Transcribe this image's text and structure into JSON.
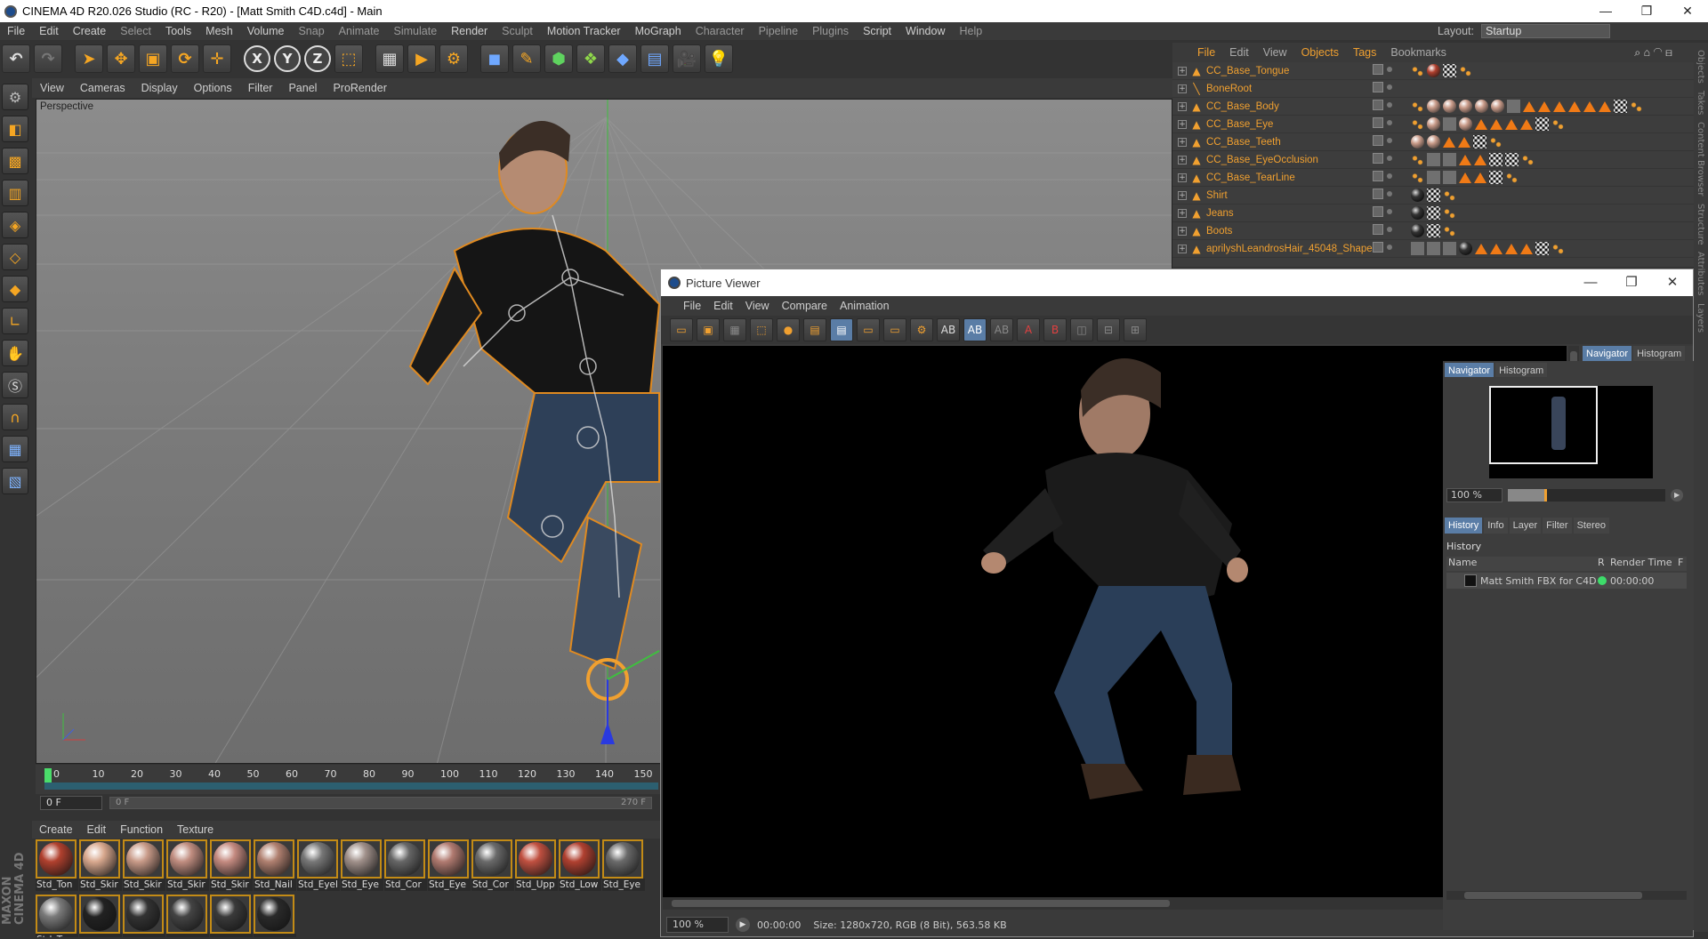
{
  "window": {
    "title": "CINEMA 4D R20.026 Studio (RC - R20) - [Matt Smith C4D.c4d] - Main",
    "min": "—",
    "max": "❐",
    "close": "✕"
  },
  "menubar": {
    "items": [
      "File",
      "Edit",
      "Create",
      "Select",
      "Tools",
      "Mesh",
      "Volume",
      "Snap",
      "Animate",
      "Simulate",
      "Render",
      "Sculpt",
      "Motion Tracker",
      "MoGraph",
      "Character",
      "Pipeline",
      "Plugins",
      "Script",
      "Window",
      "Help"
    ],
    "layout_label": "Layout:",
    "layout_value": "Startup"
  },
  "toolbar": {
    "x_label": "X",
    "y_label": "Y",
    "z_label": "Z"
  },
  "viewport": {
    "menu": [
      "View",
      "Cameras",
      "Display",
      "Options",
      "Filter",
      "Panel",
      "ProRender"
    ],
    "label": "Perspective"
  },
  "timeline": {
    "ticks": [
      "0",
      "10",
      "20",
      "30",
      "40",
      "50",
      "60",
      "70",
      "80",
      "90",
      "100",
      "110",
      "120",
      "130",
      "140",
      "150"
    ],
    "start_frame": "0 F",
    "slider_start": "0 F",
    "slider_end": "270 F"
  },
  "materials": {
    "menu": [
      "Create",
      "Edit",
      "Function",
      "Texture"
    ],
    "items": [
      {
        "label": "Std_Ton",
        "color": "#b0402e"
      },
      {
        "label": "Std_Skir",
        "color": "#d8a88e"
      },
      {
        "label": "Std_Skir",
        "color": "#c89a88"
      },
      {
        "label": "Std_Skir",
        "color": "#c08d80"
      },
      {
        "label": "Std_Skir",
        "color": "#c48a80"
      },
      {
        "label": "Std_Nail",
        "color": "#b08070"
      },
      {
        "label": "Std_Eyel",
        "color": "#777777"
      },
      {
        "label": "Std_Eye",
        "color": "#a0908a"
      },
      {
        "label": "Std_Cor",
        "color": "#666666"
      },
      {
        "label": "Std_Eye",
        "color": "#b07a70"
      },
      {
        "label": "Std_Cor",
        "color": "#6a6a6a"
      },
      {
        "label": "Std_Upp",
        "color": "#c05040"
      },
      {
        "label": "Std_Low",
        "color": "#b04030"
      },
      {
        "label": "Std_Eye",
        "color": "#6a6a6a"
      },
      {
        "label": "Std_Ton",
        "color": "#7a7a7a"
      },
      {
        "label": "",
        "color": "#222222"
      },
      {
        "label": "",
        "color": "#333333"
      },
      {
        "label": "",
        "color": "#444444"
      },
      {
        "label": "",
        "color": "#3a3a3a"
      },
      {
        "label": "",
        "color": "#2a2a2a"
      }
    ],
    "brand_top": "MAXON",
    "brand_bottom": "CINEMA 4D"
  },
  "objects": {
    "menu": [
      "File",
      "Edit",
      "View",
      "Objects",
      "Tags",
      "Bookmarks"
    ],
    "rows": [
      {
        "name": "CC_Base_Tongue",
        "tags": [
          "dots",
          "ball-red",
          "chk",
          "dots"
        ]
      },
      {
        "name": "BoneRoot",
        "tags": []
      },
      {
        "name": "CC_Base_Body",
        "tags": [
          "dots",
          "ball",
          "ball",
          "ball",
          "ball",
          "ball",
          "sq",
          "tri",
          "tri",
          "tri",
          "tri",
          "tri",
          "tri",
          "chk",
          "dots"
        ]
      },
      {
        "name": "CC_Base_Eye",
        "tags": [
          "dots",
          "ball",
          "sq",
          "ball",
          "tri",
          "tri",
          "tri",
          "tri",
          "chk",
          "dots"
        ]
      },
      {
        "name": "CC_Base_Teeth",
        "tags": [
          "ball",
          "ball",
          "tri",
          "tri",
          "chk",
          "dots"
        ]
      },
      {
        "name": "CC_Base_EyeOcclusion",
        "tags": [
          "dots",
          "sq",
          "sq",
          "tri",
          "tri",
          "chk",
          "chk",
          "dots"
        ]
      },
      {
        "name": "CC_Base_TearLine",
        "tags": [
          "dots",
          "sq",
          "sq",
          "tri",
          "tri",
          "chk",
          "dots"
        ]
      },
      {
        "name": "Shirt",
        "tags": [
          "ball-dark",
          "chk",
          "dots"
        ]
      },
      {
        "name": "Jeans",
        "tags": [
          "ball-dark",
          "chk",
          "dots"
        ]
      },
      {
        "name": "Boots",
        "tags": [
          "ball-dark",
          "chk",
          "dots"
        ]
      },
      {
        "name": "aprilyshLeandrosHair_45048_Shape",
        "tags": [
          "sq",
          "sq",
          "sq",
          "ball-dark",
          "tri",
          "tri",
          "tri",
          "tri",
          "chk",
          "dots"
        ]
      }
    ]
  },
  "picture_viewer": {
    "title": "Picture Viewer",
    "menu": [
      "File",
      "Edit",
      "View",
      "Compare",
      "Animation"
    ],
    "zoom": "100 %",
    "time": "00:00:00",
    "info": "Size: 1280x720, RGB (8 Bit), 563.58 KB",
    "nav_tabs": [
      "Navigator",
      "Histogram"
    ],
    "nav_zoom": "100 %",
    "hist_tabs": [
      "History",
      "Info",
      "Layer",
      "Filter",
      "Stereo"
    ],
    "history_heading": "History",
    "col_name": "Name",
    "col_r": "R",
    "col_time": "Render Time",
    "col_f": "F",
    "history_row": {
      "name": "Matt Smith FBX for C4D *",
      "time": "00:00:00"
    }
  },
  "side_tabs": [
    "Objects",
    "Takes",
    "Content Browser",
    "Structure",
    "Attributes",
    "Layers"
  ]
}
